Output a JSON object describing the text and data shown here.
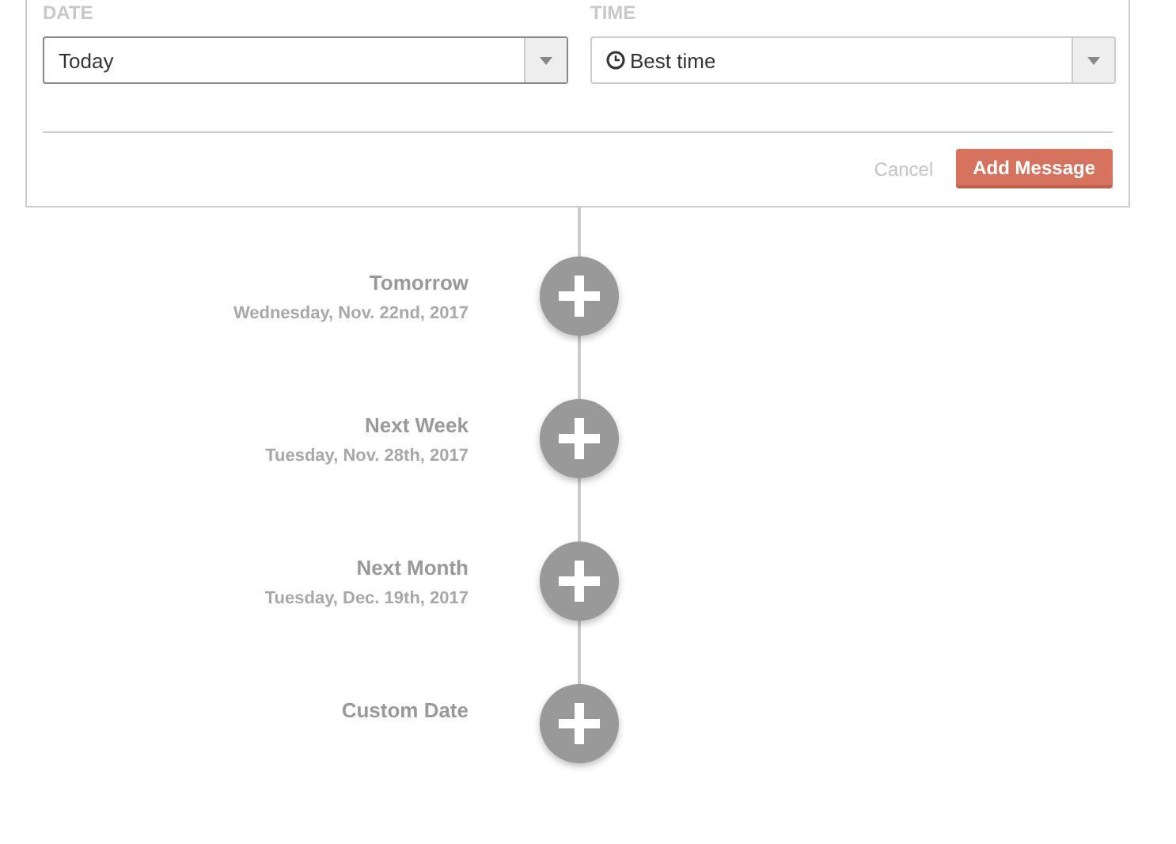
{
  "form": {
    "date": {
      "label": "DATE",
      "value": "Today"
    },
    "time": {
      "label": "TIME",
      "value": "Best time"
    },
    "buttons": {
      "cancel": "Cancel",
      "submit": "Add Message"
    }
  },
  "timeline": [
    {
      "title": "Tomorrow",
      "date": "Wednesday, Nov. 22nd, 2017"
    },
    {
      "title": "Next Week",
      "date": "Tuesday, Nov. 28th, 2017"
    },
    {
      "title": "Next Month",
      "date": "Tuesday, Dec. 19th, 2017"
    },
    {
      "title": "Custom Date"
    }
  ]
}
